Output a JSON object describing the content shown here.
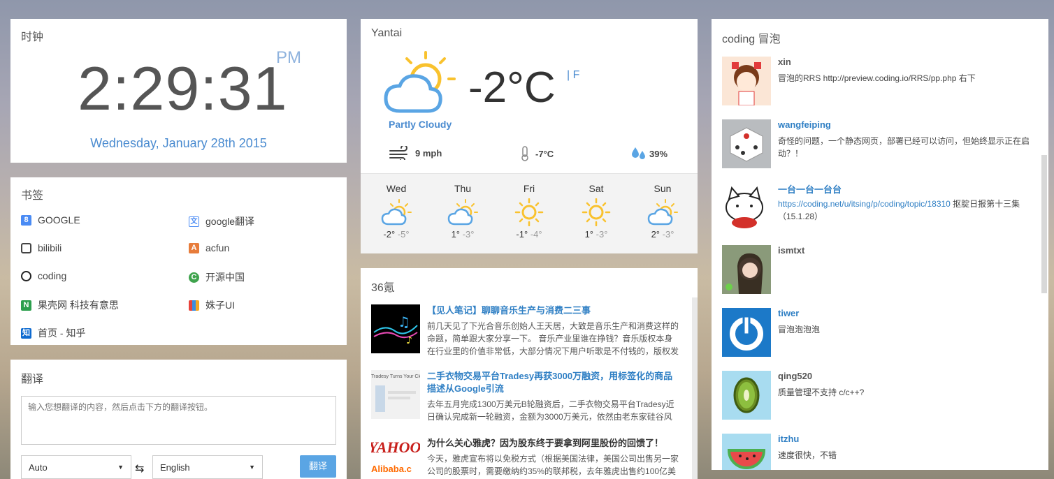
{
  "clock": {
    "title": "时钟",
    "time": "2:29:31",
    "ampm": "PM",
    "date": "Wednesday, January 28th 2015"
  },
  "bookmarks": {
    "title": "书签",
    "items": [
      {
        "label": "GOOGLE",
        "icon": "google-icon"
      },
      {
        "label": "google翻译",
        "icon": "google-translate-icon"
      },
      {
        "label": "bilibili",
        "icon": "bilibili-icon"
      },
      {
        "label": "acfun",
        "icon": "acfun-icon"
      },
      {
        "label": "coding",
        "icon": "coding-icon"
      },
      {
        "label": "开源中国",
        "icon": "oschina-icon"
      },
      {
        "label": "果壳网 科技有意思",
        "icon": "guokr-icon"
      },
      {
        "label": "姝子UI",
        "icon": "shuzi-ui-icon"
      },
      {
        "label": "首页 - 知乎",
        "icon": "zhihu-icon"
      }
    ]
  },
  "translate": {
    "title": "翻译",
    "placeholder": "输入您想翻译的内容，然后点击下方的翻译按钮。",
    "from": "Auto",
    "to": "English",
    "button": "翻译"
  },
  "weather": {
    "city": "Yantai",
    "temp": "-2°C",
    "unit_toggle": "| F",
    "condition": "Partly Cloudy",
    "wind": "9 mph",
    "feels": "-7°C",
    "humidity": "39%",
    "forecast": [
      {
        "day": "Wed",
        "hi": "-2°",
        "lo": "-5°",
        "icon": "partly-cloudy-icon"
      },
      {
        "day": "Thu",
        "hi": "1°",
        "lo": "-3°",
        "icon": "partly-cloudy-icon"
      },
      {
        "day": "Fri",
        "hi": "-1°",
        "lo": "-4°",
        "icon": "sunny-icon"
      },
      {
        "day": "Sat",
        "hi": "1°",
        "lo": "-3°",
        "icon": "sunny-icon"
      },
      {
        "day": "Sun",
        "hi": "2°",
        "lo": "-3°",
        "icon": "partly-cloudy-icon"
      }
    ],
    "colors": {
      "sun": "#f9c22e",
      "cloud": "#5aa5e4"
    }
  },
  "news": {
    "title": "36氪",
    "items": [
      {
        "title": "【见人笔记】聊聊音乐生产与消费二三事",
        "desc": "前几天见了下光合音乐创始人王天居，大致是音乐生产和消费这样的命题，简单跟大家分享一下。 音乐产业里谁在挣钱？音乐版权本身在行业里的价值非常低，大部分情况下用户听歌是不付钱的，版权发"
      },
      {
        "title": "二手衣物交易平台Tradesy再获3000万融资，用标签化的商品描述从Google引流",
        "desc": "去年五月完成1300万美元B轮融资后，二手衣物交易平台Tradesy近日确认完成新一轮融资，金额为3000万美元，依然由老东家硅谷风"
      },
      {
        "title": "为什么关心雅虎？因为股东终于要拿到阿里股份的回馈了！",
        "desc": "今天，雅虎宣布将以免税方式（根据美国法律，美国公司出售另一家公司的股票时，需要缴纳约35%的联邦税，去年雅虎出售约100亿美"
      }
    ]
  },
  "bubbles": {
    "title": "coding 冒泡",
    "items": [
      {
        "name": "xin",
        "text": "冒泡的RRS http://preview.coding.io/RRS/pp.php 右下",
        "name_color": "#555"
      },
      {
        "name": "wangfeiping",
        "text": "奇怪的问题，一个静态网页，部署已经可以访问，但始终显示正在启动？！",
        "name_color": "#2f7fc4"
      },
      {
        "name": "一台一台一台台",
        "link": "https://coding.net/u/itsing/p/coding/topic/18310",
        "text": " 抠腚日报第十三集（15.1.28）",
        "name_color": "#2f7fc4"
      },
      {
        "name": "ismtxt",
        "text": "",
        "name_color": "#555"
      },
      {
        "name": "tiwer",
        "text": "冒泡泡泡泡",
        "name_color": "#2f7fc4"
      },
      {
        "name": "qing520",
        "text": "质量管理不支持 c/c++?",
        "name_color": "#555"
      },
      {
        "name": "itzhu",
        "text": "速度很快，不错",
        "name_color": "#2f7fc4"
      }
    ]
  }
}
